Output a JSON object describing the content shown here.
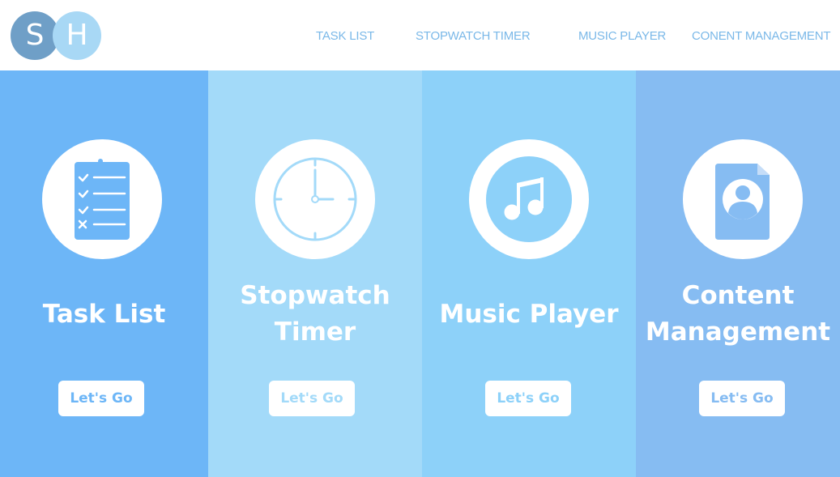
{
  "logo": {
    "letter1": "S",
    "letter2": "H"
  },
  "nav": [
    {
      "label": "TASK LIST"
    },
    {
      "label": "STOPWATCH TIMER"
    },
    {
      "label": "MUSIC PLAYER"
    },
    {
      "label": "CONENT MANAGEMENT"
    }
  ],
  "panels": [
    {
      "title": "Task List",
      "button": "Let's Go",
      "icon": "clipboard-checklist-icon",
      "color": "#6db6f7"
    },
    {
      "title_line1": "Stopwatch",
      "title_line2": "Timer",
      "button": "Let's Go",
      "icon": "clock-icon",
      "color": "#a3daf9"
    },
    {
      "title": "Music Player",
      "button": "Let's Go",
      "icon": "music-note-icon",
      "color": "#8dd1f9"
    },
    {
      "title_line1": "Content",
      "title_line2": "Management",
      "button": "Let's Go",
      "icon": "document-user-icon",
      "color": "#86bcf2"
    }
  ]
}
